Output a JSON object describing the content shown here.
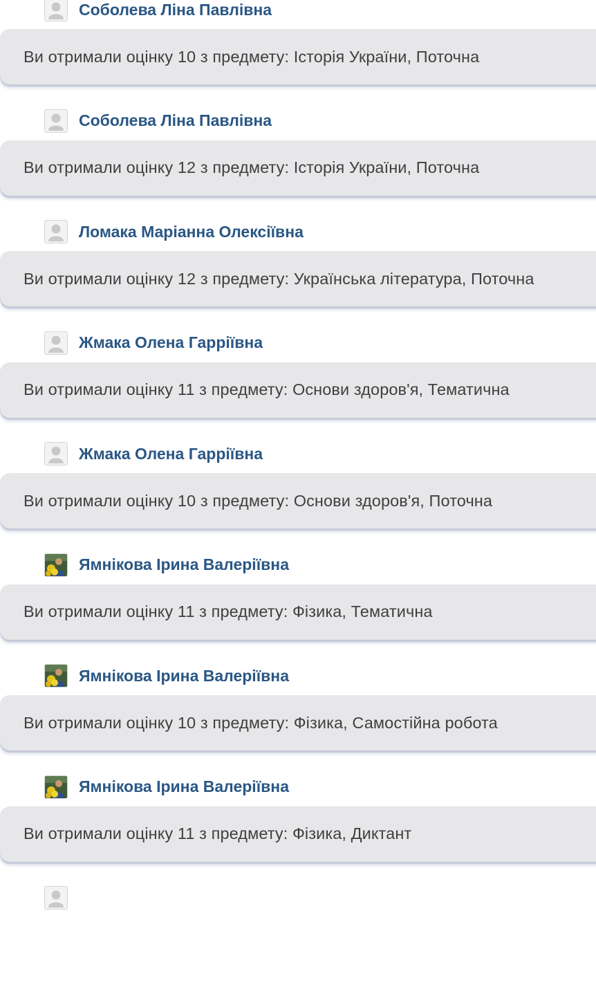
{
  "notifications": [
    {
      "sender": "Соболева Ліна Павлівна",
      "avatar_icon": "default-user-icon",
      "message": "Ви отримали оцінку 10 з предмету: Історія України, Поточна"
    },
    {
      "sender": "Соболева Ліна Павлівна",
      "avatar_icon": "default-user-icon",
      "message": "Ви отримали оцінку 12 з предмету: Історія України, Поточна"
    },
    {
      "sender": "Ломака Маріанна Олексіївна",
      "avatar_icon": "default-user-icon",
      "message": "Ви отримали оцінку 12 з предмету: Українська література, Поточна"
    },
    {
      "sender": "Жмака Олена Гарріївна",
      "avatar_icon": "default-user-icon",
      "message": "Ви отримали оцінку 11 з предмету: Основи здоров'я, Тематична"
    },
    {
      "sender": "Жмака Олена Гарріївна",
      "avatar_icon": "default-user-icon",
      "message": "Ви отримали оцінку 10 з предмету: Основи здоров'я, Поточна"
    },
    {
      "sender": "Ямнікова Ірина Валеріївна",
      "avatar_icon": "user-photo",
      "message": "Ви отримали оцінку 11 з предмету: Фізика, Тематична"
    },
    {
      "sender": "Ямнікова Ірина Валеріївна",
      "avatar_icon": "user-photo",
      "message": "Ви отримали оцінку 10 з предмету: Фізика, Самостійна робота"
    },
    {
      "sender": "Ямнікова Ірина Валеріївна",
      "avatar_icon": "user-photo",
      "message": "Ви отримали оцінку 11 з предмету: Фізика, Диктант"
    }
  ],
  "colors": {
    "sender_name": "#2a5785",
    "bubble_bg": "#e7e7e9",
    "bubble_text": "#3f3f3f"
  }
}
